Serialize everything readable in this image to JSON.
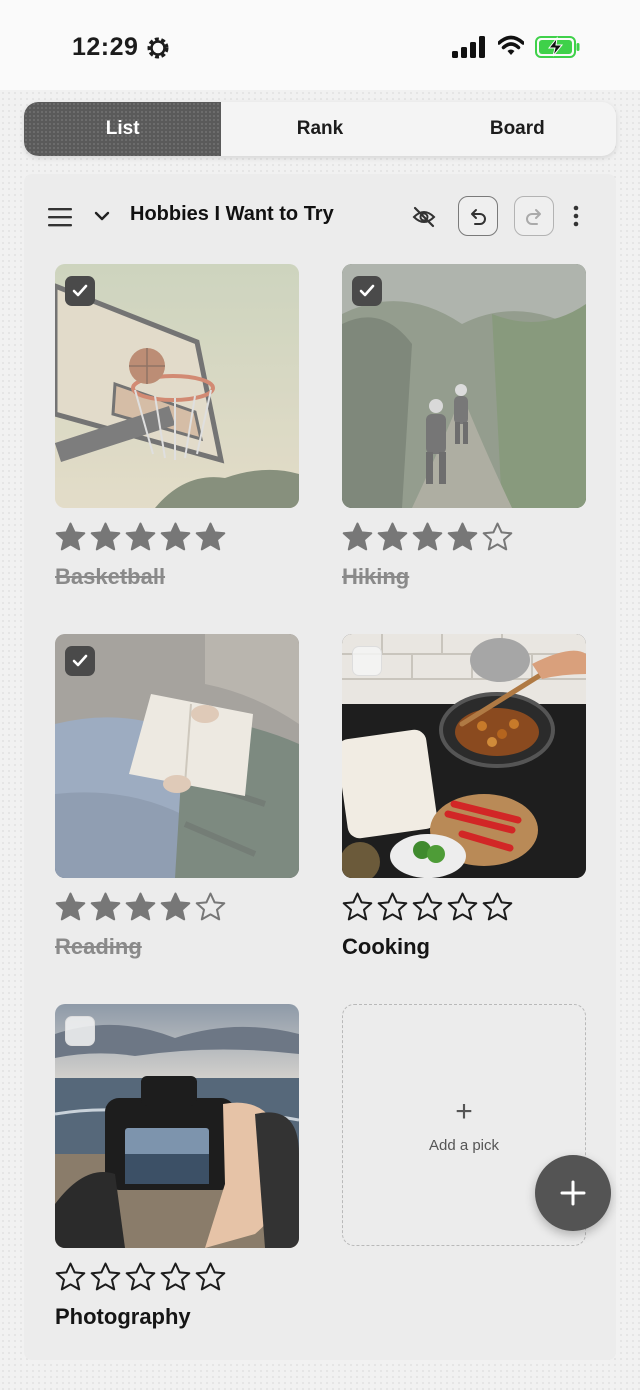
{
  "status_bar": {
    "time": "12:29",
    "icons": [
      "gear-icon",
      "signal-icon",
      "wifi-icon",
      "battery-charging-icon"
    ],
    "battery_color": "#3fd14a"
  },
  "tabs": [
    {
      "label": "List",
      "active": true
    },
    {
      "label": "Rank",
      "active": false
    },
    {
      "label": "Board",
      "active": false
    }
  ],
  "toolbar": {
    "title": "Hobbies I Want to Try",
    "icons": [
      "menu-icon",
      "chevron-down-icon",
      "hide-icon",
      "undo-icon",
      "redo-icon",
      "more-icon"
    ]
  },
  "items": [
    {
      "name": "Basketball",
      "rating": 5,
      "checked": true,
      "photo": "basketball hoop against evening sky"
    },
    {
      "name": "Hiking",
      "rating": 4,
      "checked": true,
      "photo": "hikers on a forest mountain trail"
    },
    {
      "name": "Reading",
      "rating": 4,
      "checked": true,
      "photo": "person reading a book outdoors"
    },
    {
      "name": "Cooking",
      "rating": 0,
      "checked": false,
      "photo": "cooking food in a pan on a stove"
    },
    {
      "name": "Photography",
      "rating": 0,
      "checked": false,
      "photo": "camera photographing the sea"
    }
  ],
  "add_pick": {
    "label": "Add a pick",
    "icon": "plus-icon"
  },
  "fab": {
    "icon": "plus-icon"
  },
  "colors": {
    "accent_dark": "#4a4a4a",
    "star_done": "#777777",
    "star_empty": "#1c1c1c"
  }
}
